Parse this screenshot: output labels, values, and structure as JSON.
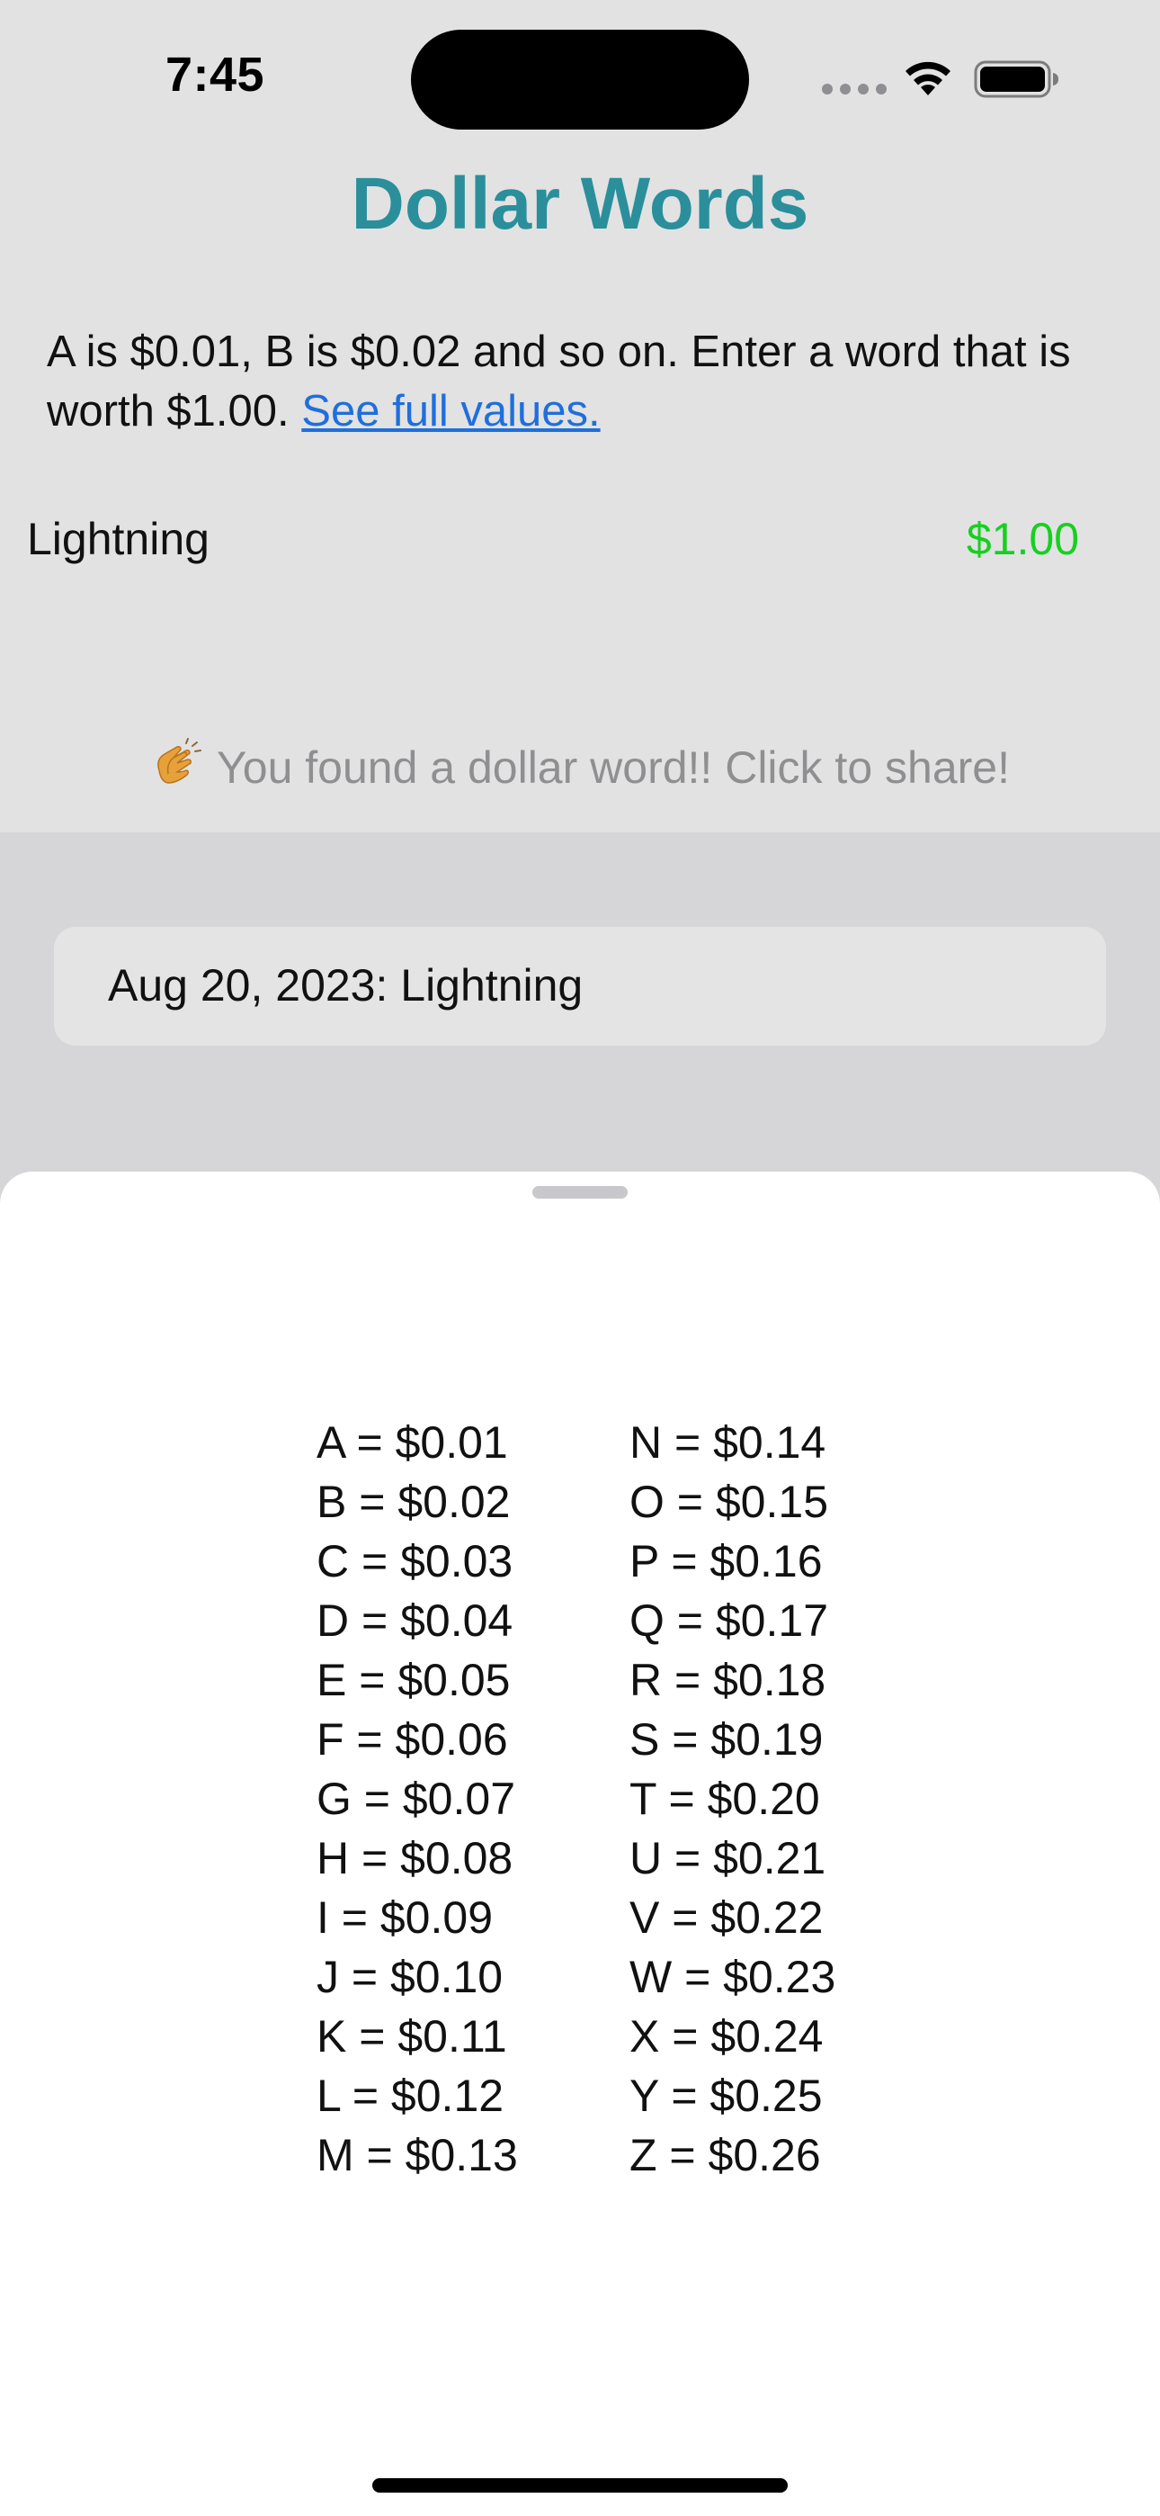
{
  "status_bar": {
    "time": "7:45"
  },
  "app": {
    "title": "Dollar Words",
    "instructions": "A is $0.01, B is $0.02 and so on. Enter a word that is worth $1.00.",
    "full_values_link": "See full values.",
    "word": "Lightning",
    "word_value": "$1.00",
    "success_message": "You found a dollar word!! Click to share!"
  },
  "history": {
    "entry": "Aug 20, 2023: Lightning"
  },
  "values_sheet": {
    "left_column": [
      "A = $0.01",
      "B = $0.02",
      "C = $0.03",
      "D = $0.04",
      "E = $0.05",
      "F = $0.06",
      "G = $0.07",
      "H = $0.08",
      "I = $0.09",
      "J = $0.10",
      "K = $0.11",
      "L = $0.12",
      "M = $0.13"
    ],
    "right_column": [
      "N = $0.14",
      "O = $0.15",
      "P = $0.16",
      "Q = $0.17",
      "R = $0.18",
      "S = $0.19",
      "T = $0.20",
      "U = $0.21",
      "V = $0.22",
      "W = $0.23",
      "X = $0.24",
      "Y = $0.25",
      "Z = $0.26"
    ]
  },
  "colors": {
    "title": "#2a8f9b",
    "link": "#1f6fdc",
    "value_positive": "#16d01f",
    "muted_text": "#8f8f91"
  },
  "icons": [
    "wifi-icon",
    "battery-icon",
    "clapping-hands-icon"
  ]
}
